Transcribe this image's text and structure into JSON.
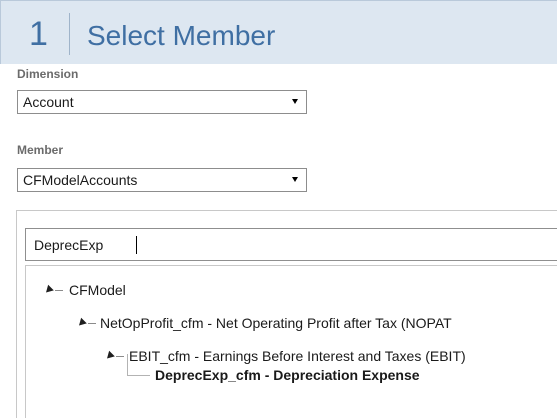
{
  "header": {
    "step": "1",
    "title": "Select Member"
  },
  "dimension": {
    "label": "Dimension",
    "value": "Account"
  },
  "member": {
    "label": "Member",
    "value": "CFModelAccounts"
  },
  "search": {
    "value": "DeprecExp"
  },
  "tree": {
    "level0": "CFModel",
    "level1": "NetOpProfit_cfm - Net Operating Profit after Tax (NOPAT",
    "level2": "EBIT_cfm - Earnings Before Interest and Taxes (EBIT)",
    "level3": "DeprecExp_cfm - Depreciation Expense"
  },
  "icons": {
    "expanded": "expanded-triangle-icon",
    "dropdown": "dropdown-arrow-icon"
  }
}
